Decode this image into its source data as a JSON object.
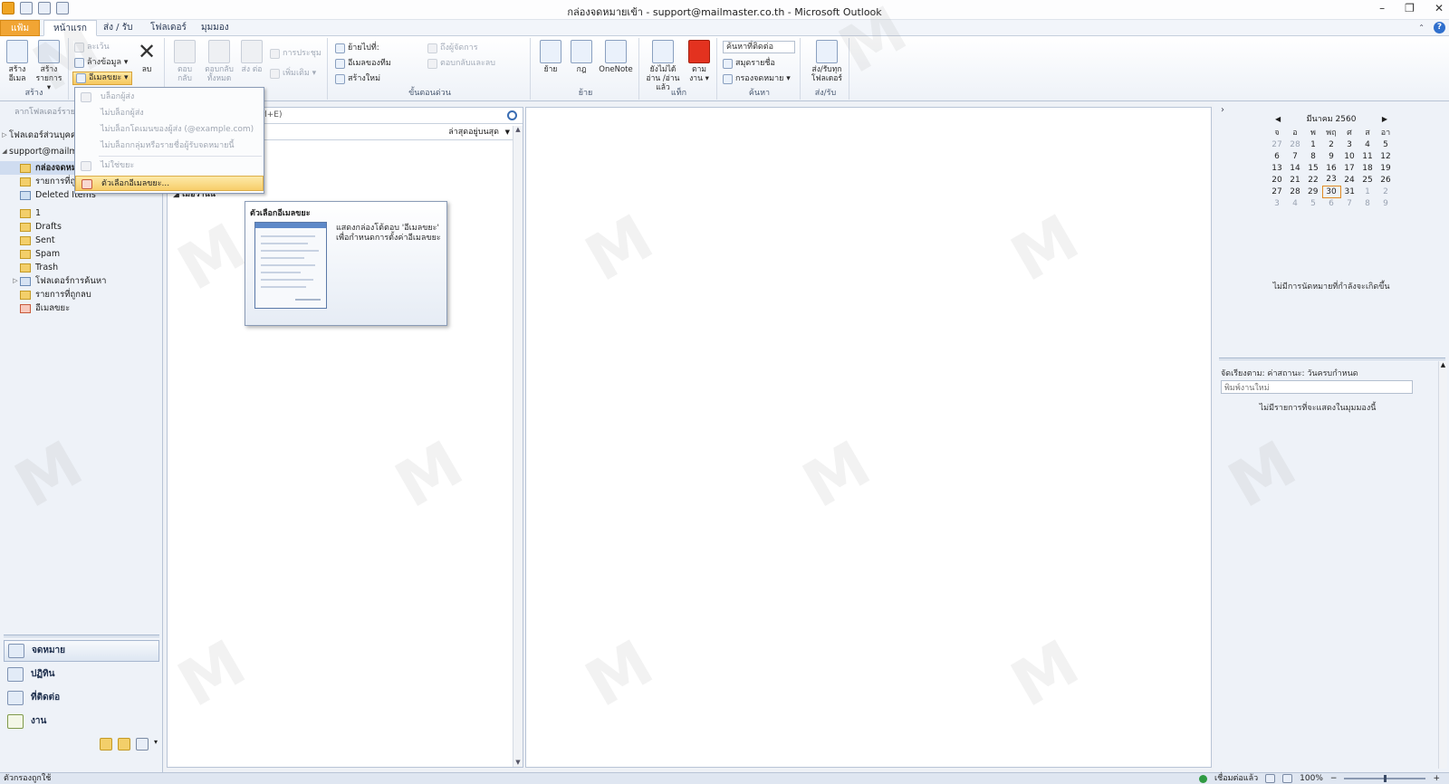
{
  "window": {
    "title": "กล่องจดหมายเข้า - support@mailmaster.co.th - Microsoft Outlook",
    "controls": [
      "–",
      "❐",
      "✕"
    ]
  },
  "tabs": {
    "file": "แฟ้ม",
    "home": "หน้าแรก",
    "send_receive": "ส่ง / รับ",
    "folder": "โฟลเดอร์",
    "view": "มุมมอง"
  },
  "ribbon": {
    "new": {
      "new_email": "สร้าง อีเมล",
      "new_items": "สร้าง รายการ ▾",
      "label": "สร้าง"
    },
    "delete": {
      "ignore": "ละเว้น",
      "clean_up": "ล้างข้อมูล ▾",
      "junk": "อีเมลขยะ ▾",
      "delete": "ลบ",
      "label": "ลบ"
    },
    "respond": {
      "reply": "ตอบ กลับ",
      "reply_all": "ตอบกลับ ทั้งหมด",
      "forward": "ส่ง ต่อ",
      "meeting": "การประชุม",
      "more": "เพิ่มเติม ▾",
      "label": "ตอบกลับ"
    },
    "quick_steps": {
      "move_to": "ย้ายไปที่:",
      "team_email": "อีเมลของทีม",
      "create_new": "สร้างใหม่",
      "to_manager": "ถึงผู้จัดการ",
      "reply_delete": "ตอบกลับและลบ",
      "label": "ขั้นตอนด่วน"
    },
    "move": {
      "move": "ย้าย",
      "rules": "กฎ",
      "onenote": "OneNote",
      "label": "ย้าย"
    },
    "tags": {
      "unread_read": "ยังไม่ได้อ่าน /อ่านแล้ว",
      "follow_up": "ตาม งาน ▾",
      "label": "แท็ก"
    },
    "find": {
      "search_people": "ค้นหาที่ติดต่อ",
      "address_book": "สมุดรายชื่อ",
      "filter_email": "กรองจดหมาย ▾",
      "label": "ค้นหา"
    },
    "send_receive": {
      "send_receive_all": "ส่ง/รับทุก โฟลเดอร์",
      "label": "ส่ง/รับ"
    }
  },
  "junk_menu": {
    "items": [
      {
        "label": "บล็อกผู้ส่ง",
        "enabled": false
      },
      {
        "label": "ไม่บล็อกผู้ส่ง",
        "enabled": false
      },
      {
        "label": "ไม่บล็อกโดเมนของผู้ส่ง (@example.com)",
        "enabled": false
      },
      {
        "label": "ไม่บล็อกกลุ่มหรือรายชื่อผู้รับจดหมายนี้",
        "enabled": false
      },
      {
        "label": "ไม่ใช่ขยะ",
        "enabled": false
      },
      {
        "label": "ตัวเลือกอีเมลขยะ...",
        "enabled": true,
        "highlighted": true
      }
    ]
  },
  "tooltip": {
    "title": "ตัวเลือกอีเมลขยะ",
    "description": "แสดงกล่องโต้ตอบ 'อีเมลขยะ' เพื่อกำหนดการตั้งค่าอีเมลขยะ"
  },
  "left_pane": {
    "drag_hint": "ลากโฟลเดอร์รายการโปรดมาที่นี่",
    "folders": [
      {
        "label": "โฟลเดอร์ส่วนบุคคล",
        "level": 0,
        "tri": "▷"
      },
      {
        "label": "support@mailmaster.co.th",
        "level": 0,
        "tri": "◢"
      },
      {
        "label": "กล่องจดหมายเข้า",
        "level": 1,
        "selected": true
      },
      {
        "label": "รายการที่ถูกส่ง",
        "level": 1
      },
      {
        "label": "Deleted Items",
        "level": 1
      },
      {
        "label": "1",
        "level": 1
      },
      {
        "label": "Drafts",
        "level": 1
      },
      {
        "label": "Sent",
        "level": 1
      },
      {
        "label": "Spam",
        "level": 1
      },
      {
        "label": "Trash",
        "level": 1
      },
      {
        "label": "โฟลเดอร์การค้นหา",
        "level": 1,
        "tri": "▷"
      },
      {
        "label": "รายการที่ถูกลบ",
        "level": 1
      },
      {
        "label": "อีเมลขยะ",
        "level": 1
      }
    ],
    "nav": {
      "mail": "จดหมาย",
      "calendar": "ปฏิทิน",
      "contacts": "ที่ติดต่อ",
      "tasks": "งาน"
    }
  },
  "mail_list": {
    "search_hint": "trl+E)",
    "sort_label": "ล่าสุดอยู่บนสุด",
    "group_header": "เมื่อวานนี้"
  },
  "calendar": {
    "month": "มีนาคม 2560",
    "days_of_week": [
      "จ",
      "อ",
      "พ",
      "พฤ",
      "ศ",
      "ส",
      "อา"
    ],
    "weeks": [
      [
        "27",
        "28",
        "1",
        "2",
        "3",
        "4",
        "5"
      ],
      [
        "6",
        "7",
        "8",
        "9",
        "10",
        "11",
        "12"
      ],
      [
        "13",
        "14",
        "15",
        "16",
        "17",
        "18",
        "19"
      ],
      [
        "20",
        "21",
        "22",
        "23",
        "24",
        "25",
        "26"
      ],
      [
        "27",
        "28",
        "29",
        "30",
        "31",
        "1",
        "2"
      ],
      [
        "3",
        "4",
        "5",
        "6",
        "7",
        "8",
        "9"
      ]
    ],
    "today": "30",
    "no_appointments": "ไม่มีการนัดหมายที่กำลังจะเกิดขึ้น"
  },
  "todo": {
    "arrange_by": "จัดเรียงตาม: ค่าสถานะ: วันครบกำหนด",
    "new_task_placeholder": "พิมพ์งานใหม่",
    "no_tasks": "ไม่มีรายการที่จะแสดงในมุมมองนี้"
  },
  "status": {
    "filter": "ตัวกรองถูกใช้",
    "connection": "เชื่อมต่อแล้ว",
    "zoom": "100%"
  },
  "colors": {
    "accent": "#f1a534",
    "highlight": "#f7cd6a",
    "selection": "#cfdcf0"
  }
}
